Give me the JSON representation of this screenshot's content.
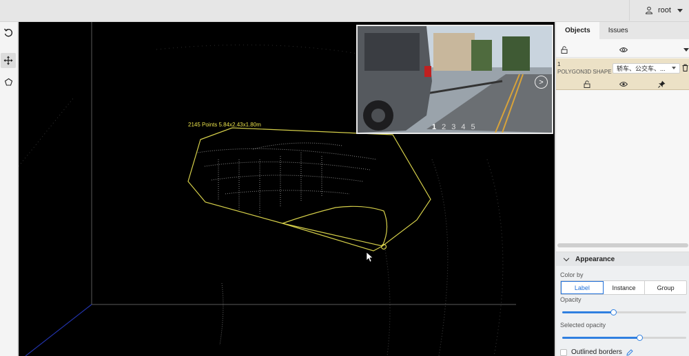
{
  "user": {
    "name": "root"
  },
  "canvas": {
    "points_label": "2145 Points 5.84x2.43x1.80m"
  },
  "camera": {
    "frames": [
      "1",
      "2",
      "3",
      "4",
      "5"
    ],
    "selected_frame": "1",
    "next_glyph": ">"
  },
  "panel": {
    "tabs": [
      "Objects",
      "Issues"
    ],
    "active_tab": "Objects",
    "object": {
      "id": "1",
      "type": "POLYGON3D SHAPE",
      "label_value": "轿车、公交车、..."
    }
  },
  "appearance": {
    "title": "Appearance",
    "color_by_label": "Color by",
    "color_by_options": [
      "Label",
      "Instance",
      "Group"
    ],
    "color_by_selected": "Label",
    "opacity_label": "Opacity",
    "opacity_value": 0.41,
    "selected_opacity_label": "Selected opacity",
    "selected_opacity_value": 0.62,
    "outlined_borders_label": "Outlined borders"
  },
  "colors": {
    "accent": "#2f7fe0",
    "cuboid": "#d6d04a",
    "object_card": "#ece1c6"
  }
}
